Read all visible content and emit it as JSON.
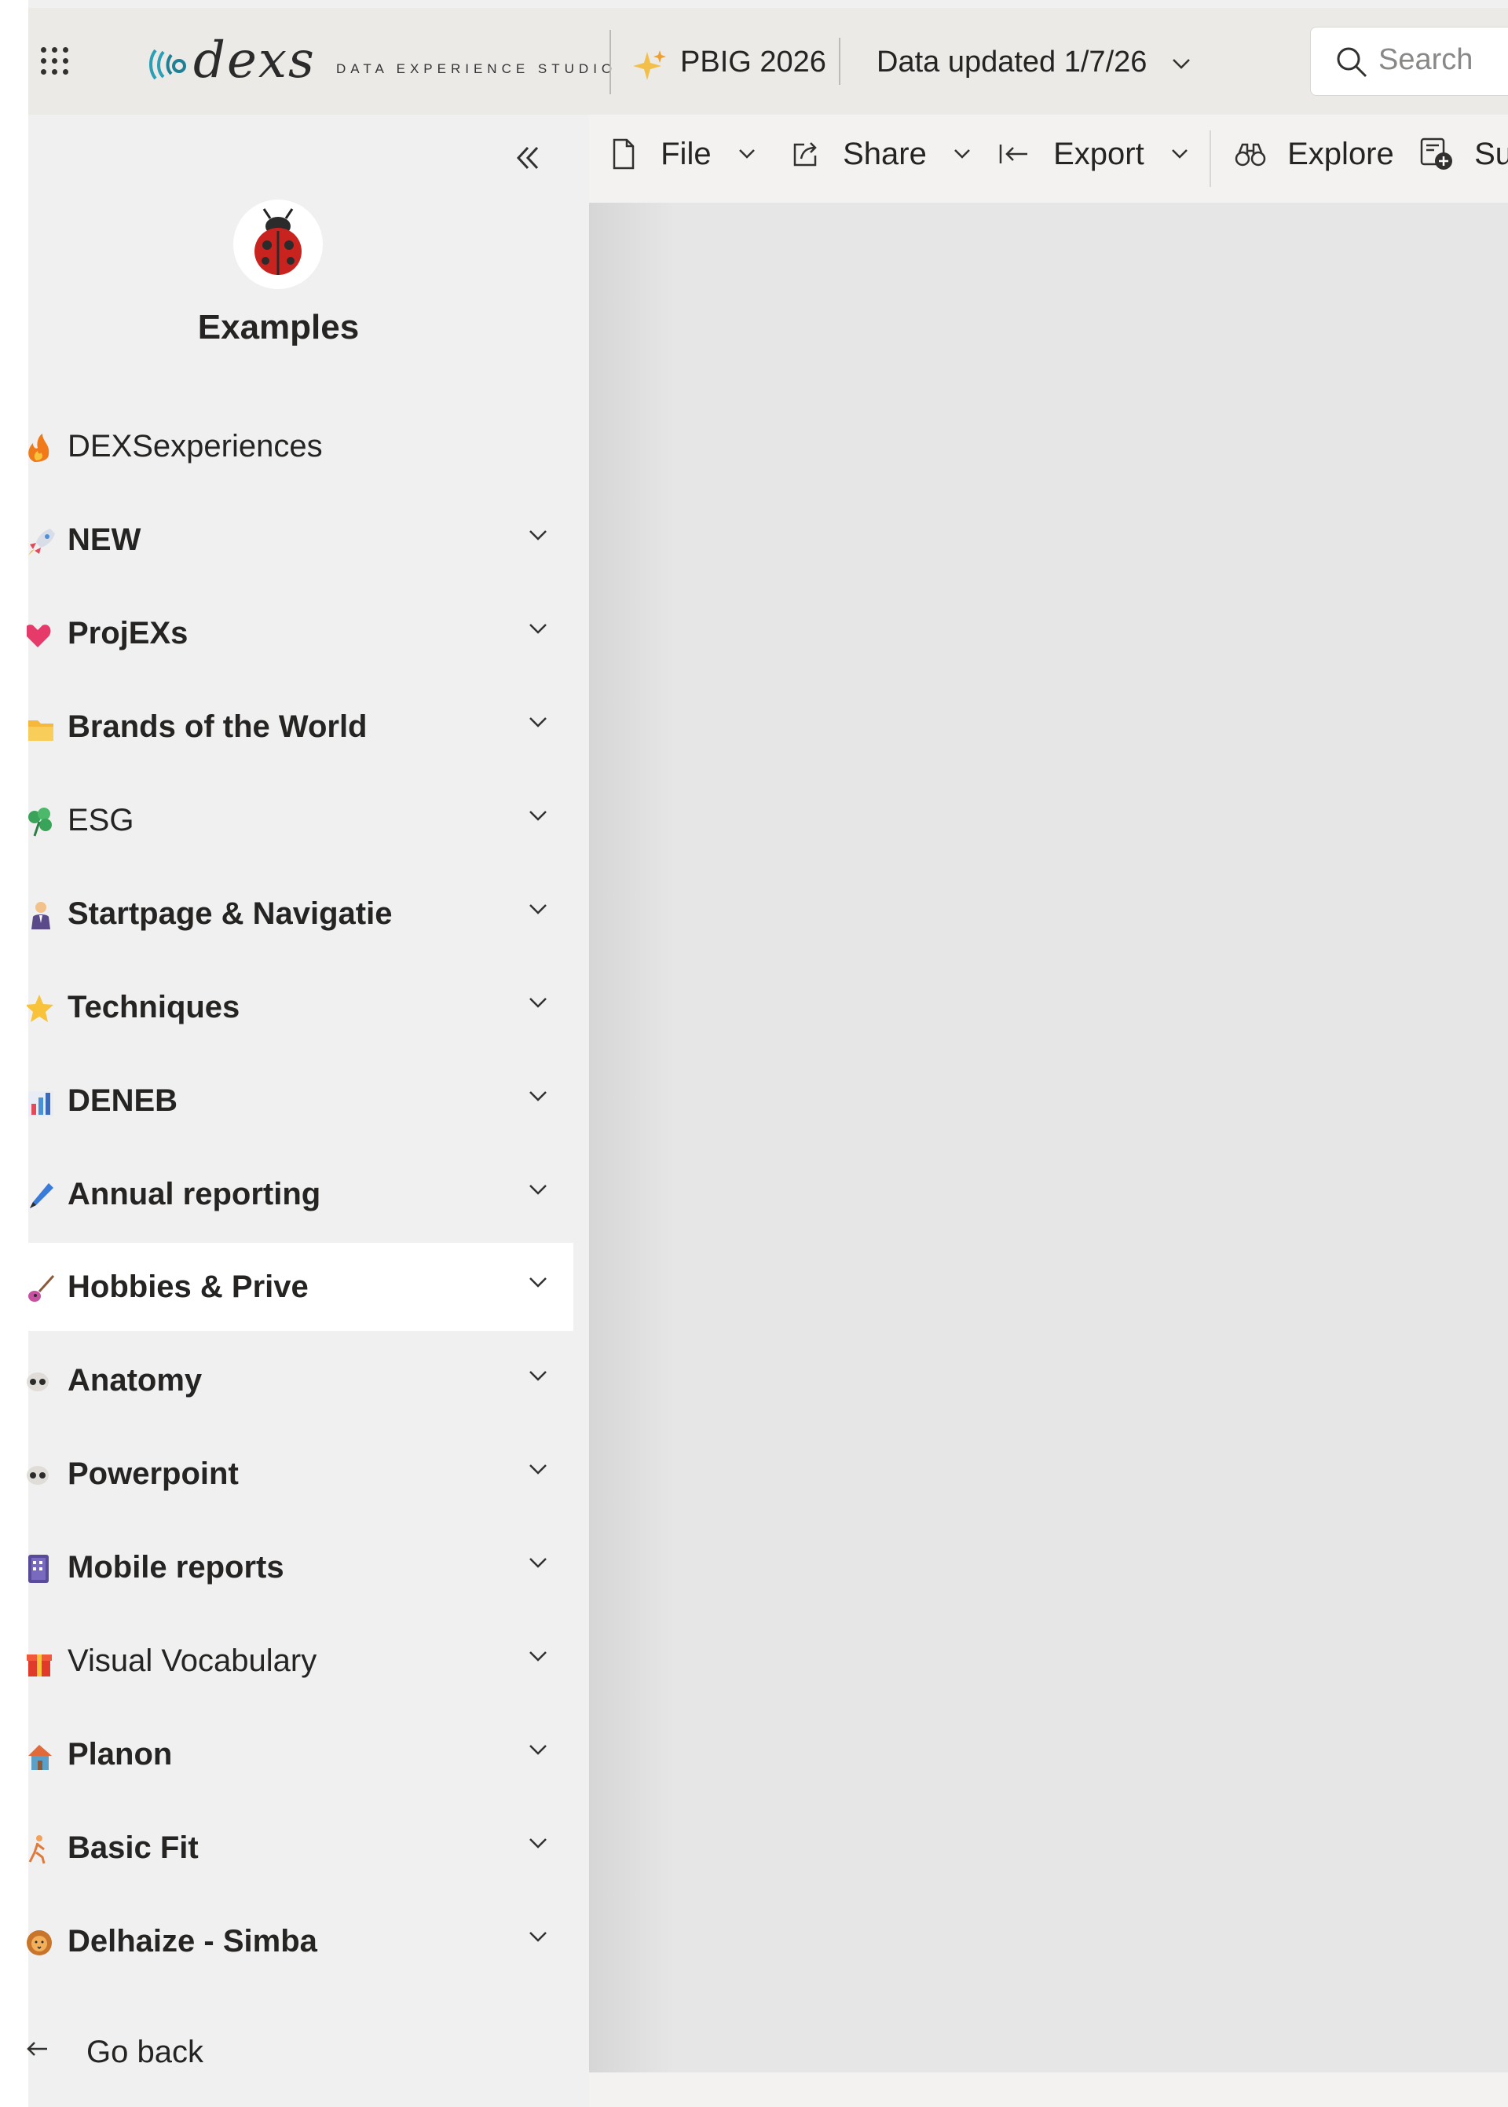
{
  "header": {
    "logo_word": "dexs",
    "logo_tagline": "DATA EXPERIENCE STUDIO",
    "workspace_name": "PBIG 2026",
    "data_updated": "Data updated 1/7/26",
    "search_placeholder": "Search"
  },
  "sidebar": {
    "title": "Examples",
    "items": [
      {
        "label": "DEXSexperiences",
        "icon": "fire-icon",
        "bold": false,
        "chevron": false
      },
      {
        "label": "NEW",
        "icon": "rocket-icon",
        "bold": true,
        "chevron": true
      },
      {
        "label": "ProjEXs",
        "icon": "heart-icon",
        "bold": true,
        "chevron": true
      },
      {
        "label": "Brands of the World",
        "icon": "folder-icon",
        "bold": true,
        "chevron": true
      },
      {
        "label": "ESG",
        "icon": "clover-icon",
        "bold": false,
        "chevron": true
      },
      {
        "label": "Startpage & Navigatie",
        "icon": "person-icon",
        "bold": true,
        "chevron": true
      },
      {
        "label": "Techniques",
        "icon": "star-icon",
        "bold": true,
        "chevron": true
      },
      {
        "label": "DENEB",
        "icon": "bar-chart-icon",
        "bold": true,
        "chevron": true
      },
      {
        "label": "Annual reporting",
        "icon": "pen-icon",
        "bold": true,
        "chevron": true
      },
      {
        "label": "Hobbies & Prive",
        "icon": "guitar-icon",
        "bold": true,
        "chevron": true,
        "active": true
      },
      {
        "label": "Anatomy",
        "icon": "skull-icon",
        "bold": true,
        "chevron": true
      },
      {
        "label": "Powerpoint",
        "icon": "skull-icon",
        "bold": true,
        "chevron": true
      },
      {
        "label": "Mobile reports",
        "icon": "mobile-icon",
        "bold": true,
        "chevron": true
      },
      {
        "label": "Visual Vocabulary",
        "icon": "gift-icon",
        "bold": false,
        "chevron": true
      },
      {
        "label": "Planon",
        "icon": "house-icon",
        "bold": true,
        "chevron": true
      },
      {
        "label": "Basic Fit",
        "icon": "runner-icon",
        "bold": true,
        "chevron": true
      },
      {
        "label": "Delhaize - Simba",
        "icon": "lion-icon",
        "bold": true,
        "chevron": true
      }
    ],
    "go_back": "Go back"
  },
  "toolbar": {
    "file": "File",
    "share": "Share",
    "export": "Export",
    "explore": "Explore",
    "subscribe": "Su"
  }
}
